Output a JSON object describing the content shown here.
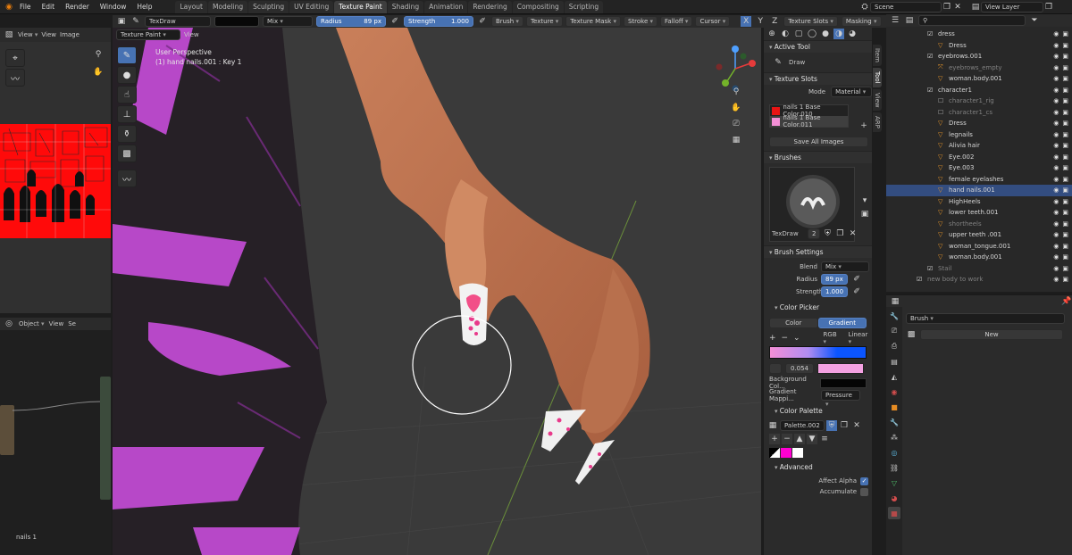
{
  "menubar": {
    "menus": [
      "File",
      "Edit",
      "Render",
      "Window",
      "Help"
    ],
    "workspaces": [
      "Layout",
      "Modeling",
      "Sculpting",
      "UV Editing",
      "Texture Paint",
      "Shading",
      "Animation",
      "Rendering",
      "Compositing",
      "Scripting"
    ],
    "active_workspace": "Texture Paint",
    "scene": "Scene",
    "view_layer": "View Layer"
  },
  "toolheader": {
    "brush": "TexDraw",
    "blend": "Mix",
    "radius_label": "Radius",
    "radius_value": "89 px",
    "strength_label": "Strength",
    "strength_value": "1.000",
    "menus": [
      "Brush",
      "Texture",
      "Texture Mask",
      "Stroke",
      "Falloff",
      "Cursor"
    ],
    "right_btns": [
      "Texture Slots",
      "Masking"
    ]
  },
  "viewport_header": {
    "mode": "Texture Paint",
    "view": "View"
  },
  "image_editor": {
    "view": "View",
    "view2": "View",
    "image": "Image"
  },
  "node_editor": {
    "object": "Object",
    "view": "View",
    "sel": "Se",
    "label": "nails 1"
  },
  "viewport": {
    "perspective": "User Perspective",
    "object_info": "(1) hand nails.001 : Key 1"
  },
  "npanel": {
    "active_tool_title": "Active Tool",
    "active_tool_name": "Draw",
    "texture_slots_title": "Texture Slots",
    "mode_label": "Mode",
    "mode_value": "Material",
    "slots": [
      {
        "name": "nails 1 Base Color.010",
        "color": "#e81414"
      },
      {
        "name": "nails 1 Base Color.011",
        "color": "#f48fd6"
      }
    ],
    "save_all": "Save All Images",
    "brushes_title": "Brushes",
    "brush_name": "TexDraw",
    "brush_users": "2",
    "brush_settings_title": "Brush Settings",
    "blend_label": "Blend",
    "blend_value": "Mix",
    "radius_label": "Radius",
    "radius_value": "89 px",
    "strength_label": "Strength",
    "strength_value": "1.000",
    "color_picker_title": "Color Picker",
    "color_tab": "Color",
    "gradient_tab": "Gradient",
    "rgb": "RGB",
    "interp": "Linear",
    "gradient_pos": "0.054",
    "bg_color_label": "Background Col...",
    "grad_map_label": "Gradient Mappi...",
    "grad_map_value": "Pressure",
    "palette_title": "Color Palette",
    "palette_name": "Palette.002",
    "advanced_title": "Advanced",
    "affect_alpha": "Affect Alpha",
    "accumulate": "Accumulate",
    "side_tabs": [
      "Item",
      "Tool",
      "View",
      "ARP"
    ]
  },
  "outliner": {
    "rows": [
      {
        "name": "dress",
        "indent": 1,
        "icon": "collection"
      },
      {
        "name": "Dress",
        "indent": 2,
        "icon": "mesh"
      },
      {
        "name": "eyebrows.001",
        "indent": 1,
        "icon": "collection"
      },
      {
        "name": "eyebrows_empty",
        "indent": 2,
        "icon": "empty",
        "dim": true
      },
      {
        "name": "woman.body.001",
        "indent": 2,
        "icon": "mesh"
      },
      {
        "name": "character1",
        "indent": 1,
        "icon": "collection"
      },
      {
        "name": "character1_rig",
        "indent": 2,
        "icon": "armature",
        "dim": true
      },
      {
        "name": "character1_cs",
        "indent": 2,
        "icon": "armature",
        "dim": true
      },
      {
        "name": "Dress",
        "indent": 2,
        "icon": "mesh"
      },
      {
        "name": "legnails",
        "indent": 2,
        "icon": "mesh"
      },
      {
        "name": "Alivia hair",
        "indent": 2,
        "icon": "mesh"
      },
      {
        "name": "Eye.002",
        "indent": 2,
        "icon": "mesh"
      },
      {
        "name": "Eye.003",
        "indent": 2,
        "icon": "mesh"
      },
      {
        "name": "female eyelashes",
        "indent": 2,
        "icon": "mesh"
      },
      {
        "name": "hand nails.001",
        "indent": 2,
        "icon": "mesh",
        "selected": true
      },
      {
        "name": "HighHeels",
        "indent": 2,
        "icon": "mesh"
      },
      {
        "name": "lower teeth.001",
        "indent": 2,
        "icon": "mesh"
      },
      {
        "name": "shortheels",
        "indent": 2,
        "icon": "mesh",
        "dim": true
      },
      {
        "name": "upper teeth .001",
        "indent": 2,
        "icon": "mesh"
      },
      {
        "name": "woman_tongue.001",
        "indent": 2,
        "icon": "mesh"
      },
      {
        "name": "woman.body.001",
        "indent": 2,
        "icon": "mesh"
      },
      {
        "name": "Stail",
        "indent": 1,
        "icon": "collection",
        "dim": true
      },
      {
        "name": "new body to work",
        "indent": 0,
        "icon": "collection",
        "dim": true
      }
    ]
  },
  "propeditor": {
    "brush_label": "Brush",
    "new_button": "New"
  }
}
